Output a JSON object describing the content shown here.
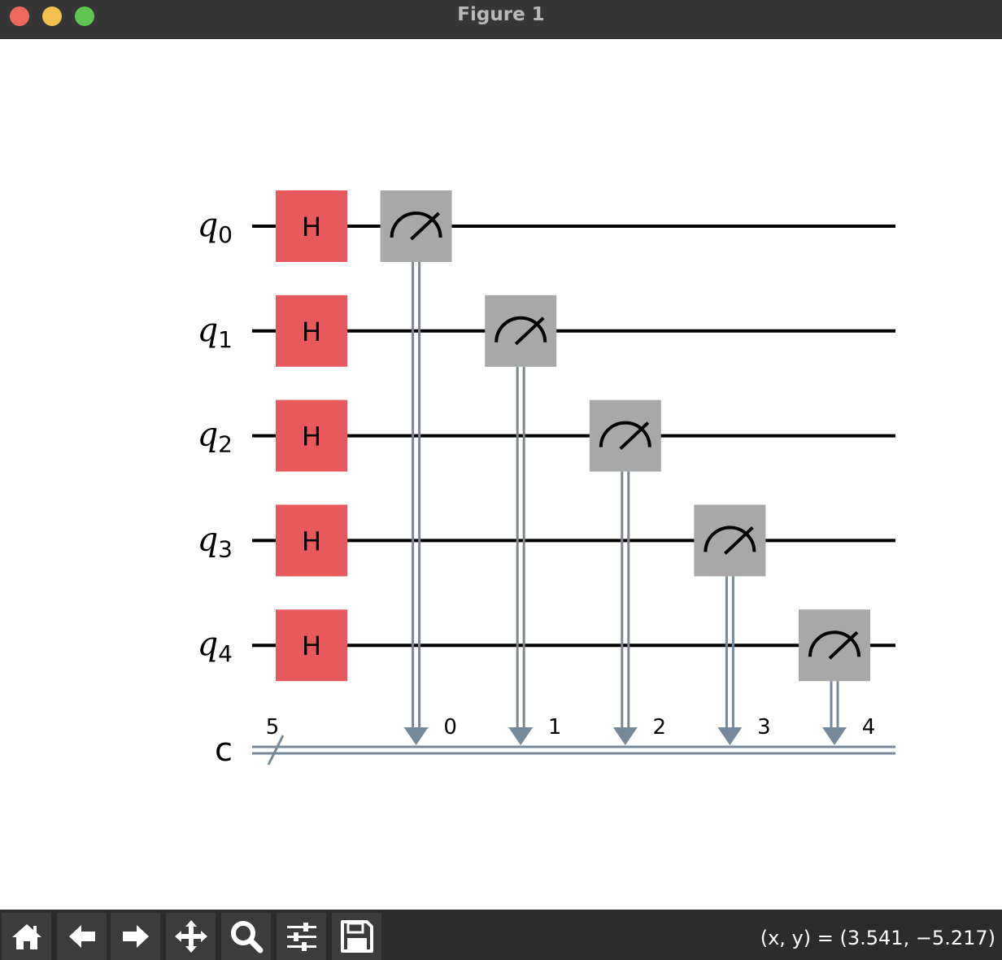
{
  "window": {
    "title": "Figure 1"
  },
  "circuit": {
    "qubits": [
      {
        "label": "q",
        "index": "0"
      },
      {
        "label": "q",
        "index": "1"
      },
      {
        "label": "q",
        "index": "2"
      },
      {
        "label": "q",
        "index": "3"
      },
      {
        "label": "q",
        "index": "4"
      }
    ],
    "classical_register": {
      "label": "c",
      "size": "5"
    },
    "gates": [
      {
        "type": "H",
        "label": "H",
        "qubit": 0,
        "column": 0
      },
      {
        "type": "H",
        "label": "H",
        "qubit": 1,
        "column": 0
      },
      {
        "type": "H",
        "label": "H",
        "qubit": 2,
        "column": 0
      },
      {
        "type": "H",
        "label": "H",
        "qubit": 3,
        "column": 0
      },
      {
        "type": "H",
        "label": "H",
        "qubit": 4,
        "column": 0
      },
      {
        "type": "measure",
        "qubit": 0,
        "clbit": "0",
        "column": 1
      },
      {
        "type": "measure",
        "qubit": 1,
        "clbit": "1",
        "column": 2
      },
      {
        "type": "measure",
        "qubit": 2,
        "clbit": "2",
        "column": 3
      },
      {
        "type": "measure",
        "qubit": 3,
        "clbit": "3",
        "column": 4
      },
      {
        "type": "measure",
        "qubit": 4,
        "clbit": "4",
        "column": 5
      }
    ],
    "colors": {
      "h_gate": "#e8595d",
      "measure_gate": "#a8a8a8",
      "wire": "#000000",
      "classical_wire": "#778899"
    }
  },
  "toolbar": {
    "buttons": [
      {
        "name": "home-button",
        "icon": "home-icon"
      },
      {
        "name": "back-button",
        "icon": "arrow-left-icon"
      },
      {
        "name": "forward-button",
        "icon": "arrow-right-icon"
      },
      {
        "name": "pan-button",
        "icon": "move-icon"
      },
      {
        "name": "zoom-button",
        "icon": "magnifier-icon"
      },
      {
        "name": "configure-subplots-button",
        "icon": "sliders-icon"
      },
      {
        "name": "save-button",
        "icon": "floppy-disk-icon"
      }
    ],
    "coordinates": "(x, y) = (3.541, −5.217)"
  }
}
